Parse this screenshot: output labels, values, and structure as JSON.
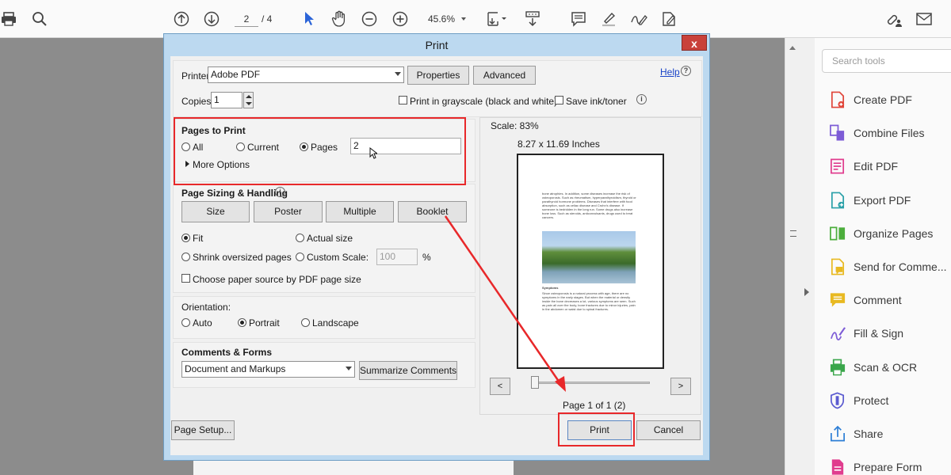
{
  "viewer": {
    "page_current": "2",
    "page_total": "/ 4",
    "zoom": "45.6%"
  },
  "tools_panel": {
    "search_placeholder": "Search tools",
    "items": [
      {
        "label": "Create PDF",
        "icon": "create-pdf-icon",
        "color": "#e0463a"
      },
      {
        "label": "Combine Files",
        "icon": "combine-files-icon",
        "color": "#7d5cd6"
      },
      {
        "label": "Edit PDF",
        "icon": "edit-pdf-icon",
        "color": "#e03c8e"
      },
      {
        "label": "Export PDF",
        "icon": "export-pdf-icon",
        "color": "#2aa0a8"
      },
      {
        "label": "Organize Pages",
        "icon": "organize-pages-icon",
        "color": "#4cae3c"
      },
      {
        "label": "Send for Comme...",
        "icon": "send-for-comment-icon",
        "color": "#e8b921"
      },
      {
        "label": "Comment",
        "icon": "comment-icon",
        "color": "#e8b921"
      },
      {
        "label": "Fill & Sign",
        "icon": "fill-sign-icon",
        "color": "#7d5cd6"
      },
      {
        "label": "Scan & OCR",
        "icon": "scan-ocr-icon",
        "color": "#3aa64b"
      },
      {
        "label": "Protect",
        "icon": "protect-icon",
        "color": "#5b5bd0"
      },
      {
        "label": "Share",
        "icon": "share-icon",
        "color": "#2e7fd6"
      },
      {
        "label": "Prepare Form",
        "icon": "prepare-form-icon",
        "color": "#e03c8e"
      }
    ]
  },
  "dialog": {
    "title": "Print",
    "close": "x",
    "printer_label": "Printer:",
    "printer_value": "Adobe PDF",
    "properties": "Properties",
    "advanced": "Advanced",
    "help": "Help",
    "copies_label": "Copies:",
    "copies_value": "1",
    "grayscale": "Print in grayscale (black and white)",
    "save_ink": "Save ink/toner",
    "pages_to_print": {
      "title": "Pages to Print",
      "all": "All",
      "current": "Current",
      "pages": "Pages",
      "pages_value": "2",
      "more_options": "More Options"
    },
    "sizing": {
      "title": "Page Sizing & Handling",
      "size": "Size",
      "poster": "Poster",
      "multiple": "Multiple",
      "booklet": "Booklet",
      "fit": "Fit",
      "actual_size": "Actual size",
      "shrink": "Shrink oversized pages",
      "custom_scale": "Custom Scale:",
      "custom_value": "100",
      "percent": "%",
      "paper_source": "Choose paper source by PDF page size"
    },
    "orientation": {
      "title": "Orientation:",
      "auto": "Auto",
      "portrait": "Portrait",
      "landscape": "Landscape"
    },
    "comments": {
      "title": "Comments & Forms",
      "value": "Document and Markups",
      "summarize": "Summarize Comments"
    },
    "preview": {
      "scale": "Scale:  83%",
      "size": "8.27 x 11.69 Inches",
      "prev": "<",
      "next": ">",
      "page_info": "Page 1 of 1 (2)",
      "text_top": "bone atrophies. In addition, some diseases increase the risk of osteoporosis. Such as rheumatism, hyperparathyroidism, thyroid or parathyroid hormone problems. Diseases that interfere with food absorption, such as celiac disease and Crohn's disease. If someone is bedridden in the long run. Some drugs also increase bone loss. Such as steroids, anticonvulsants, drugs used to treat cancers.",
      "caption": "Symptoms",
      "text_bottom": "Since osteoporosis is a natural process with age, there are no symptoms in the early stages. But when the material or density inside the bone decreases a lot, various symptoms are seen. Such as pain all over the body, bone fractures due to minor injuries, pain in the abdomen or waist due to spinal fractures."
    },
    "page_setup": "Page Setup...",
    "print": "Print",
    "cancel": "Cancel"
  },
  "colors": {
    "highlight": "#e8282a",
    "title_bar": "#bcd9f0",
    "close": "#c9413a"
  }
}
